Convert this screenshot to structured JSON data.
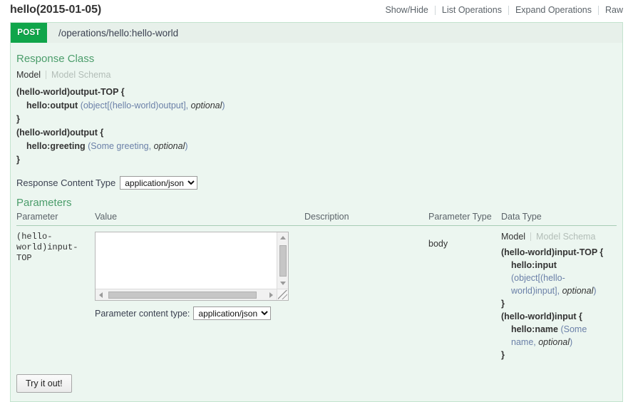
{
  "resource": {
    "title": "hello(2015-01-05)",
    "options": [
      {
        "label": "Show/Hide"
      },
      {
        "label": "List Operations"
      },
      {
        "label": "Expand Operations"
      },
      {
        "label": "Raw"
      }
    ]
  },
  "operation": {
    "method": "POST",
    "path": "/operations/hello:hello-world",
    "method_color": "#10a54a"
  },
  "response_class": {
    "heading": "Response Class",
    "tabs": {
      "model": "Model",
      "model_schema": "Model Schema"
    },
    "model": {
      "line1_name": "(hello-world)output-TOP {",
      "line2_name": "hello:output",
      "line2_type": "(object[(hello-world)output], ",
      "line2_optional": "optional",
      "line2_close": ")",
      "line3_brace": "}",
      "line4_name": "(hello-world)output {",
      "line5_name": "hello:greeting",
      "line5_type": "(Some greeting, ",
      "line5_optional": "optional",
      "line5_close": ")",
      "line6_brace": "}"
    },
    "content_type_label": "Response Content Type",
    "content_type_value": "application/json",
    "content_type_options": [
      "application/json"
    ]
  },
  "parameters": {
    "heading": "Parameters",
    "columns": {
      "parameter": "Parameter",
      "value": "Value",
      "description": "Description",
      "parameter_type": "Parameter Type",
      "data_type": "Data Type"
    },
    "row": {
      "name": "(hello-world)input-TOP",
      "value": "",
      "value_placeholder": "",
      "description": "",
      "parameter_type": "body",
      "param_content_type_label": "Parameter content type:",
      "param_content_type_value": "application/json",
      "param_content_type_options": [
        "application/json"
      ],
      "data_type": {
        "tabs": {
          "model": "Model",
          "model_schema": "Model Schema"
        },
        "line1_name": "(hello-world)input-TOP {",
        "line2_name": "hello:input",
        "line2_type": "(object[(hello-world)input], ",
        "line2_optional": "optional",
        "line2_close": ")",
        "line3_brace": "}",
        "line4_name": "(hello-world)input {",
        "line5_name": "hello:name",
        "line5_type": "(Some name, ",
        "line5_optional": "optional",
        "line5_close": ")",
        "line6_brace": "}"
      }
    }
  },
  "actions": {
    "try_it_out": "Try it out!"
  }
}
